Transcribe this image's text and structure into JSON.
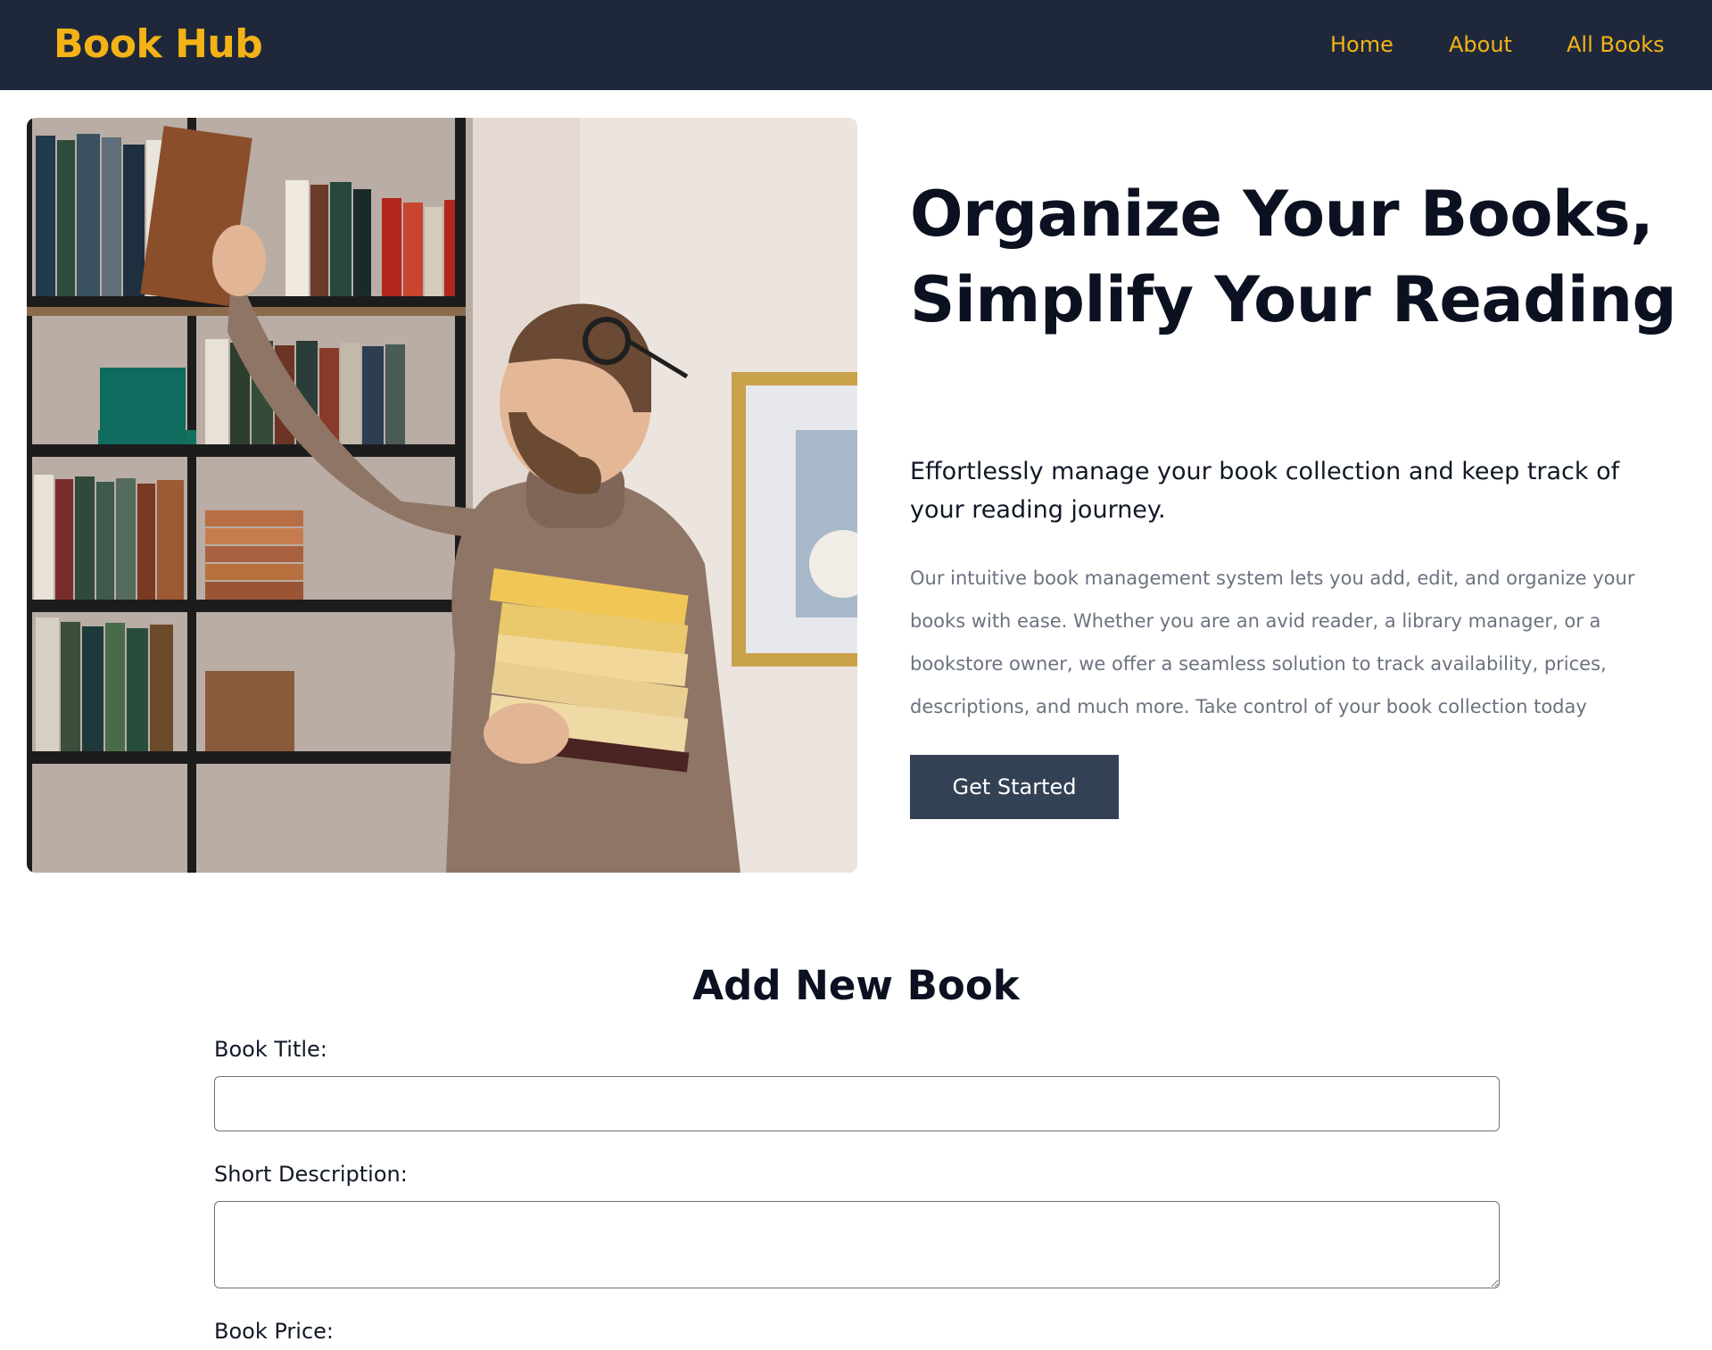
{
  "navbar": {
    "brand": "Book Hub",
    "links": [
      {
        "label": "Home"
      },
      {
        "label": "About"
      },
      {
        "label": "All Books"
      }
    ],
    "background_color": "#1f283b",
    "accent_color": "#f3b316"
  },
  "hero": {
    "title": "Organize Your Books, Simplify Your Reading",
    "subtitle": "Effortlessly manage your book collection and keep track of your reading journey.",
    "body": "Our intuitive book management system lets you add, edit, and organize your books with ease. Whether you are an avid reader, a library manager, or a bookstore owner, we offer a seamless solution to track availability, prices, descriptions, and much more. Take control of your book collection today",
    "cta_label": "Get Started",
    "cta_color": "#334155",
    "image_icon": "man-reaching-bookshelf-photo"
  },
  "form": {
    "heading": "Add New Book",
    "fields": [
      {
        "label": "Book Title:",
        "value": "",
        "placeholder": ""
      },
      {
        "label": "Short Description:",
        "value": "",
        "placeholder": ""
      },
      {
        "label": "Book Price:"
      }
    ]
  }
}
